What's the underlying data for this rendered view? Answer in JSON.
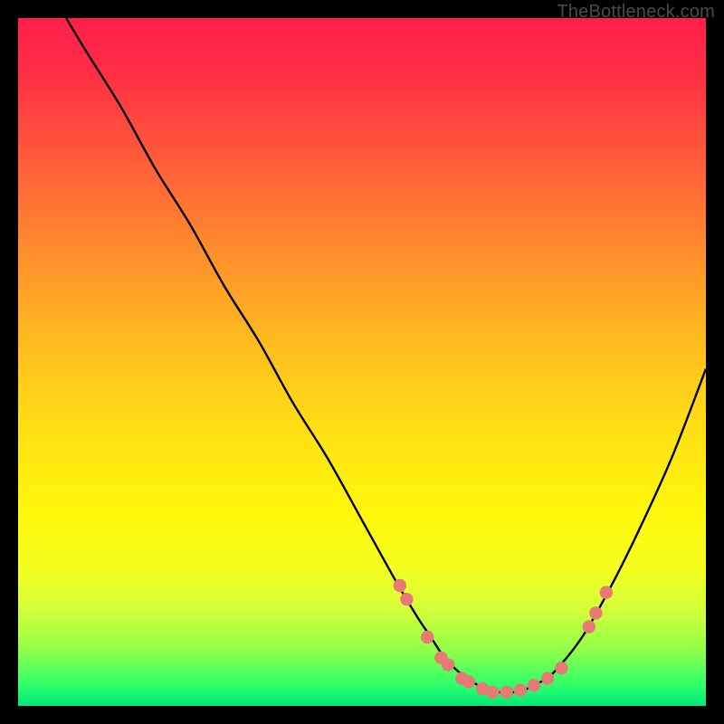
{
  "watermark": "TheBottleneck.com",
  "chart_data": {
    "type": "line",
    "title": "",
    "xlabel": "",
    "ylabel": "",
    "xlim": [
      0,
      100
    ],
    "ylim": [
      0,
      100
    ],
    "series": [
      {
        "name": "bottleneck-curve",
        "x": [
          7,
          10,
          15,
          20,
          25,
          30,
          35,
          40,
          45,
          50,
          55,
          58,
          60,
          62,
          64,
          66,
          68,
          70,
          72,
          74,
          76,
          78,
          82,
          86,
          90,
          95,
          100
        ],
        "y": [
          100,
          95,
          87,
          78,
          70,
          61,
          53,
          44,
          36,
          27,
          18,
          13,
          10,
          7,
          5,
          3.5,
          2.5,
          2,
          2,
          2.5,
          3.5,
          5,
          10,
          17,
          25,
          36,
          49
        ]
      }
    ],
    "points": {
      "name": "highlight-points",
      "x": [
        55.5,
        56.5,
        59.5,
        61.5,
        62.5,
        64.5,
        65.5,
        67.5,
        69.0,
        71.0,
        73.0,
        75.0,
        77.0,
        79.0,
        83.0,
        84.0,
        85.5
      ],
      "y": [
        17.5,
        15.5,
        10.0,
        7.0,
        6.0,
        4.0,
        3.5,
        2.5,
        2.0,
        2.0,
        2.3,
        3.0,
        4.0,
        5.5,
        11.5,
        13.5,
        16.5
      ]
    },
    "colors": {
      "curve": "#000000",
      "points": "#e77a74",
      "gradient_top": "#ff1f4a",
      "gradient_bottom": "#00e87a"
    }
  }
}
